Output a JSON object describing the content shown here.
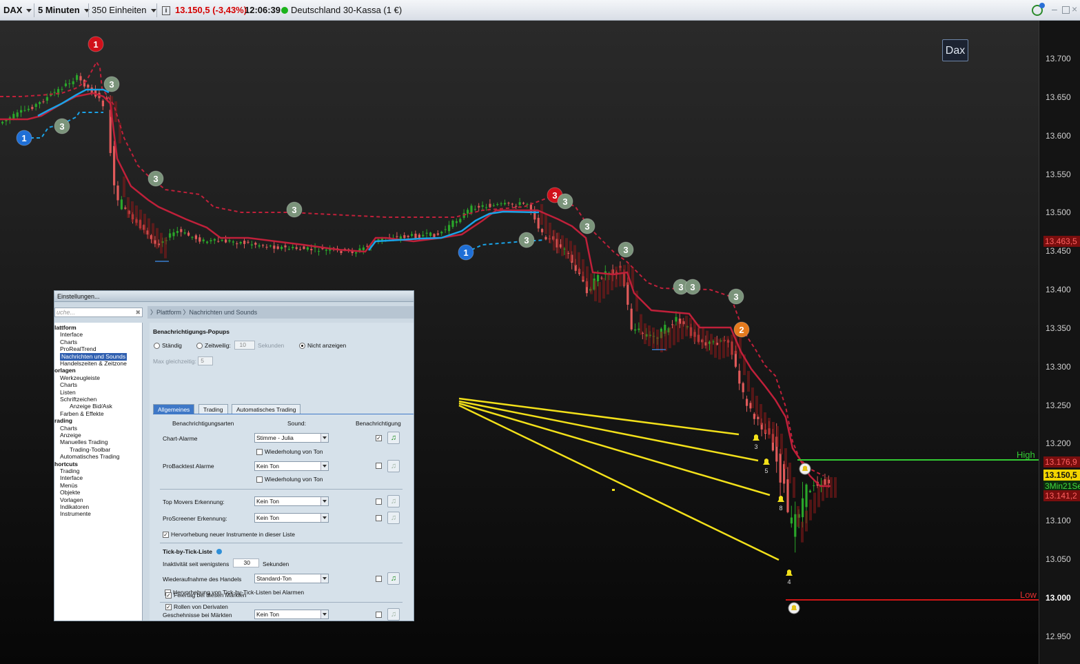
{
  "toolbar": {
    "instrument": "DAX",
    "timeframe": "5 Minuten",
    "units": "350 Einheiten",
    "price_change": "13.150,5 (-3,43%)",
    "time": "12:06:39",
    "market_name": "Deutschland 30-Kassa (1 €)"
  },
  "chart": {
    "dax_label": "Dax",
    "high_label": "High",
    "low_label": "Low",
    "y_ticks": [
      "13.700",
      "13.650",
      "13.600",
      "13.550",
      "13.500",
      "13.450",
      "13.400",
      "13.350",
      "13.300",
      "13.250",
      "13.200",
      "13.100",
      "13.050",
      "13.000",
      "12.950"
    ],
    "price_labels": {
      "p1": "13.463,5",
      "p2": "13.176,9",
      "current": "13.150,5",
      "timer": "3Min21Se",
      "p3": "13.141,2"
    },
    "alert_numbers": [
      "3",
      "5",
      "8",
      "4"
    ],
    "signals": [
      "1",
      "3",
      "3",
      "1",
      "3",
      "3",
      "1",
      "3",
      "3",
      "3",
      "3",
      "3",
      "3",
      "3",
      "3",
      "2"
    ],
    "colors": {
      "bull": "#2aa62a",
      "bear": "#e05a5a",
      "trend_red": "#c0203a",
      "trend_blue": "#1aa3e8",
      "high": "#33cc33",
      "low": "#d01515",
      "alert": "#f2e01a"
    }
  },
  "dialog": {
    "title": "Einstellungen...",
    "search_placeholder": "uche...",
    "breadcrumb": "〉Plattform 〉Nachrichten und Sounds",
    "tree": [
      {
        "label": "lattform",
        "bold": true
      },
      {
        "label": "Interface"
      },
      {
        "label": "Charts"
      },
      {
        "label": "ProRealTrend"
      },
      {
        "label": "Nachrichten und Sounds",
        "selected": true
      },
      {
        "label": "Handelszeiten & Zeitzone"
      },
      {
        "label": "orlagen",
        "bold": true
      },
      {
        "label": "Werkzeugleiste"
      },
      {
        "label": "Charts"
      },
      {
        "label": "Listen"
      },
      {
        "label": "Schriftzeichen"
      },
      {
        "label": "Anzeige Bid/Ask"
      },
      {
        "label": "Farben & Effekte"
      },
      {
        "label": "rading",
        "bold": true
      },
      {
        "label": "Charts"
      },
      {
        "label": "Anzeige"
      },
      {
        "label": "Manuelles Trading"
      },
      {
        "label": "Trading-Toolbar"
      },
      {
        "label": "Automatisches Trading"
      },
      {
        "label": "hortcuts",
        "bold": true
      },
      {
        "label": "Trading"
      },
      {
        "label": "Interface"
      },
      {
        "label": "Menüs"
      },
      {
        "label": "Objekte"
      },
      {
        "label": "Vorlagen"
      },
      {
        "label": "Indikatoren"
      },
      {
        "label": "Instrumente"
      }
    ],
    "popups_header": "Benachrichtigungs-Popups",
    "radio_always": "Ständig",
    "radio_temp": "Zeitweilig:",
    "temp_value": "10",
    "temp_unit": "Sekunden",
    "radio_never": "Nicht anzeigen",
    "max_label": "Max gleichzeitig:",
    "max_value": "5",
    "tabs": [
      "Allgemeines",
      "Trading",
      "Automatisches Trading"
    ],
    "col_types": "Benachrichtigungsarten",
    "col_sound": "Sound:",
    "col_notify": "Benachrichtigung",
    "chart_alarms": "Chart-Alarme",
    "chart_alarms_sound": "Stimme - Julia",
    "repeat": "Wiederholung von Ton",
    "probacktest": "ProBacktest Alarme",
    "no_sound": "Kein Ton",
    "top_movers": "Top Movers Erkennung:",
    "proscreener": "ProScreener Erkennung:",
    "highlight_new": "Hervorhebung neuer Instrumente in dieser Liste",
    "tick_header": "Tick-by-Tick-Liste",
    "inactivity": "Inaktivität seit wenigstens",
    "inactivity_value": "30",
    "seconds": "Sekunden",
    "resume": "Wiederaufnahme des Handels",
    "standard_sound": "Standard-Ton",
    "highlight_tick": "Hervorhebung von Tick-by-Tick-Listen bei Alarmen",
    "market_events": "Geschehnisse bei Märkten",
    "holiday": "Feiertag bei diesen Märkten",
    "rollover": "Rollen von Derivaten"
  }
}
